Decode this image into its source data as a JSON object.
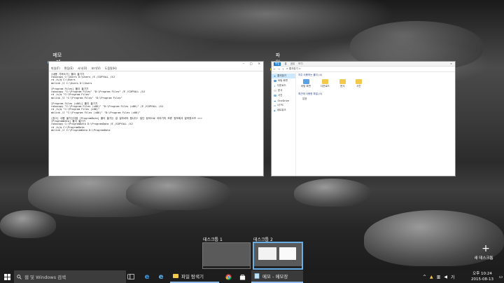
{
  "windows": {
    "notepad": {
      "title": "메모 - 메모장",
      "menu": [
        "파일(F)",
        "편집(E)",
        "서식(O)",
        "보기(V)",
        "도움말(H)"
      ],
      "lines": [
        "[내용 가져오기] 폴더 옮기기",
        "robocopy C:\\Users D:\\Users /E /COPYALL /XJ",
        "rd /s/q C:\\Users",
        "mklink /J C:\\Users D:\\Users",
        "",
        "[Program Files] 폴더 옮기기",
        "robocopy \"C:\\Program Files\" \"D:\\Program Files\" /E /COPYALL /XJ",
        "rd /s/q \"C:\\Program Files\"",
        "mklink /J \"C:\\Program Files\" \"D:\\Program Files\"",
        "",
        "[Program Files (x86)] 폴더 옮기기",
        "robocopy \"C:\\Program Files (x86)\" \"D:\\Program Files (x86)\" /E /COPYALL /XJ",
        "rd /s/q \"C:\\Program Files (x86)\"",
        "mklink /J \"C:\\Program Files (x86)\" \"D:\\Program Files (x86)\"",
        "",
        "[참고] 내용 옮기는다음 [ProgramData] 폴더 옮기는 걸 겁하셔야 합니다! 일단 탐색으로 이야기의 보류 정보에서 잘하였으므 >>>",
        "[ProgramData] 폴더 옮기기",
        "robocopy C:\\ProgramData D:\\ProgramData /E /COPYALL /XJ",
        "rd /s/q C:\\ProgramData",
        "mklink /J C:\\ProgramData D:\\ProgramData"
      ]
    },
    "explorer": {
      "title": "파일 탐색기",
      "ribbon": [
        "파일",
        "홈",
        "공유",
        "보기"
      ],
      "address": "> 즐겨찾기 >",
      "nav": [
        "즐겨찾기",
        "바탕 화면",
        "다운로드",
        "문서",
        "사진",
        "OneDrive",
        "내 PC",
        "네트워크"
      ],
      "quick_access_header": "자주 사용하는 폴더 (4)",
      "folders": [
        "바탕 화면",
        "다운로드",
        "문서",
        "사진"
      ],
      "recent_header": "최근에 사용한 파일 (0)",
      "recent_item": "없음"
    }
  },
  "desktops": [
    {
      "label": "데스크톱 1"
    },
    {
      "label": "데스크톱 2"
    }
  ],
  "new_desktop_label": "새 데스크톱",
  "taskbar": {
    "search_placeholder": "웹 및 Windows 검색",
    "apps": [
      {
        "label": "파일 탐색기"
      },
      {
        "label": "메모 - 메모장"
      }
    ],
    "language": "가",
    "time": "오후 10:24",
    "date": "2015-08-13"
  }
}
